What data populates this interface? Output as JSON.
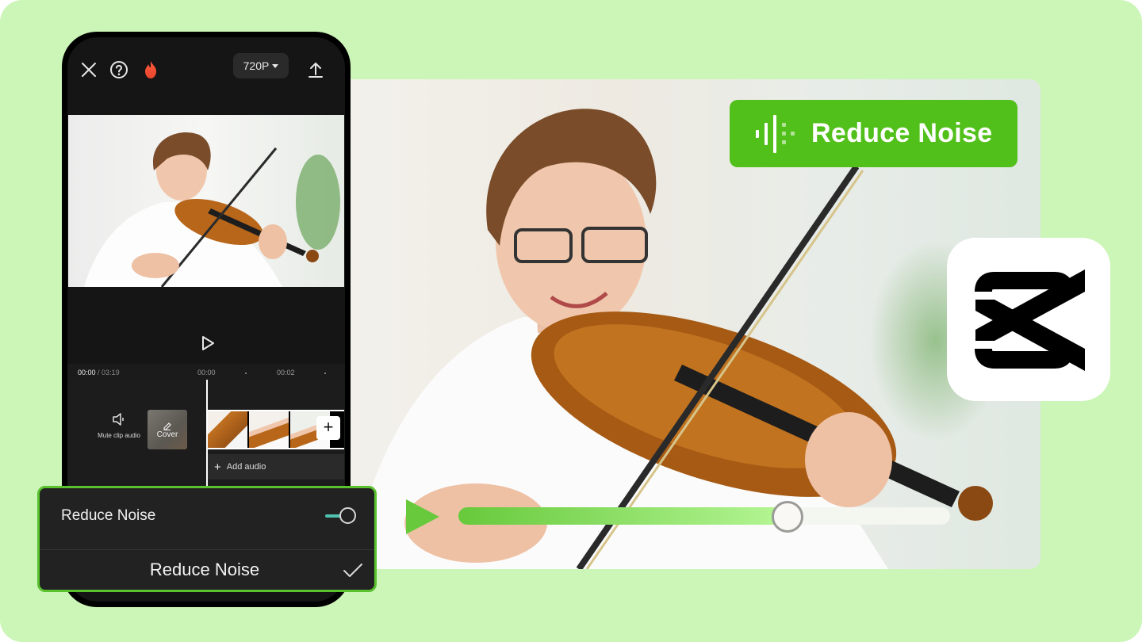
{
  "phone": {
    "topbar": {
      "close_icon": "close-icon",
      "help_icon": "help-icon",
      "trending_icon": "flame-icon",
      "resolution": "720P",
      "export_icon": "export-icon"
    },
    "timeline": {
      "current_time": "00:00",
      "separator": " / ",
      "total_time": "03:19",
      "ticks": [
        "00:00",
        "00:02"
      ]
    },
    "tracks": {
      "mute_label": "Mute clip audio",
      "cover_label": "Cover",
      "add_clip_label": "+",
      "add_audio_label": "Add audio",
      "add_audio_plus": "+"
    }
  },
  "noise_panel": {
    "toggle_label": "Reduce Noise",
    "toggle_on": true,
    "title": "Reduce Noise"
  },
  "badge": {
    "label": "Reduce Noise",
    "icon": "audio-waveform-icon"
  },
  "logo": {
    "name": "CapCut",
    "icon": "capcut-logo-icon"
  },
  "slider": {
    "value_fraction": 0.67
  },
  "colors": {
    "background": "#ccf5b8",
    "accent_green": "#52c01b",
    "toggle_teal": "#4fc2b0",
    "phone_bg": "#151515"
  }
}
